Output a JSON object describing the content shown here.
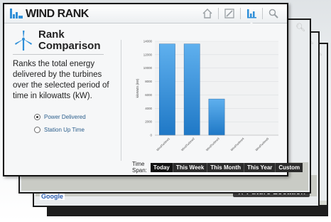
{
  "app": {
    "title": "WIND RANK"
  },
  "header_icons": [
    "home-icon",
    "chart-edit-icon",
    "bar-chart-icon",
    "search-icon"
  ],
  "panel": {
    "title_line1": "Rank",
    "title_line2": "Comparison",
    "description": "Ranks the total energy delivered by the turbines over the selected period of time in kilowatts (kW)."
  },
  "metrics": {
    "options": [
      "Power Delivered",
      "Station Up Time"
    ],
    "selected": "Power Delivered"
  },
  "time_span": {
    "label": "Time Span:",
    "options": [
      "Today",
      "This Week",
      "This Month",
      "This Year",
      "Custom"
    ],
    "selected": "Today"
  },
  "background_cards": {
    "future_location": "Future Location",
    "map_logo": "Google"
  },
  "colors": {
    "accent": "#2f8fd8",
    "bar_top": "#5fb0ee",
    "bar_bottom": "#1f78c6"
  },
  "chart_data": {
    "type": "bar",
    "categories": [
      "WindTurbine1",
      "WindTurbine2",
      "WindTurbine3",
      "WindTurbine4",
      "WindTurbine5"
    ],
    "values": [
      13600,
      13600,
      5400,
      0,
      0
    ],
    "ylabel": "kiloWatts (kW)",
    "ylim": [
      0,
      14000
    ],
    "yticks": [
      0,
      2000,
      4000,
      6000,
      8000,
      10000,
      12000,
      14000
    ],
    "grid": true
  }
}
